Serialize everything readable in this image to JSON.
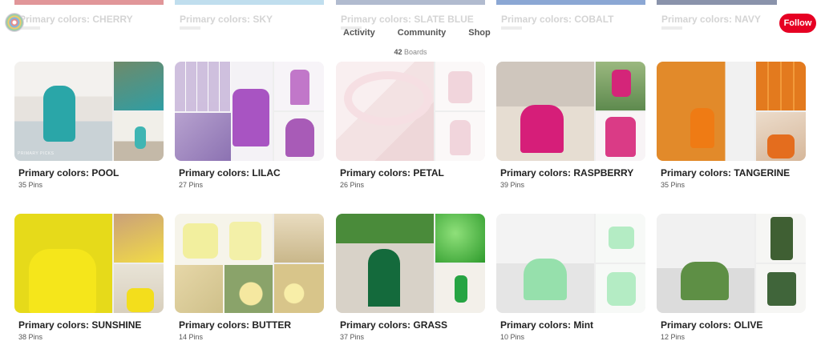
{
  "ghost_boards": [
    {
      "title": "Primary colors: CHERRY",
      "color": "#c94045"
    },
    {
      "title": "Primary colors: SKY",
      "color": "#8cc3e0"
    },
    {
      "title": "Primary colors: SLATE BLUE",
      "color": "#7184a8"
    },
    {
      "title": "Primary colors: COBALT",
      "color": "#2b5fb0"
    },
    {
      "title": "Primary colors: NAVY",
      "color": "#2a3a66"
    }
  ],
  "nav": {
    "tabs": [
      "Activity",
      "Community",
      "Shop"
    ]
  },
  "follow_label": "Follow",
  "board_count": {
    "number": "42",
    "label": "Boards"
  },
  "watermark": "PRIMARY PICKS",
  "boards": [
    {
      "title": "Primary colors: POOL",
      "pins": "35 Pins",
      "key": "pool"
    },
    {
      "title": "Primary colors: LILAC",
      "pins": "27 Pins",
      "key": "lilac"
    },
    {
      "title": "Primary colors: PETAL",
      "pins": "26 Pins",
      "key": "petal"
    },
    {
      "title": "Primary colors: RASPBERRY",
      "pins": "39 Pins",
      "key": "rasp"
    },
    {
      "title": "Primary colors: TANGERINE",
      "pins": "35 Pins",
      "key": "tang"
    },
    {
      "title": "Primary colors: SUNSHINE",
      "pins": "38 Pins",
      "key": "sun"
    },
    {
      "title": "Primary colors: BUTTER",
      "pins": "14 Pins",
      "key": "butter"
    },
    {
      "title": "Primary colors: GRASS",
      "pins": "37 Pins",
      "key": "grass"
    },
    {
      "title": "Primary colors: Mint",
      "pins": "10 Pins",
      "key": "mint"
    },
    {
      "title": "Primary colors: OLIVE",
      "pins": "12 Pins",
      "key": "olive"
    }
  ],
  "colors": {
    "brand_red": "#e60023"
  }
}
